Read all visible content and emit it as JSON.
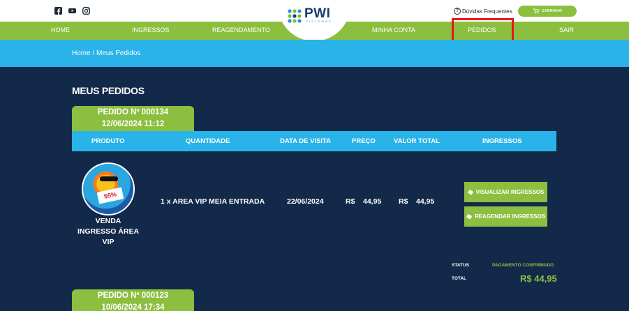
{
  "header": {
    "help_label": "Dúvidas Frequentes",
    "cart_label": "CARRINHO",
    "logo_text": "PWI",
    "logo_sub": "SISTEMAS"
  },
  "nav": {
    "items": [
      {
        "label": "HOME"
      },
      {
        "label": "INGRESSOS"
      },
      {
        "label": "REAGENDAMENTO"
      },
      {
        "label": "MINHA CONTA"
      },
      {
        "label": "PEDIDOS"
      },
      {
        "label": "SAIR"
      }
    ]
  },
  "breadcrumb": "Home / Meus Pedidos",
  "page_title": "MEUS PEDIDOS",
  "table_headers": [
    "PRODUTO",
    "QUANTIDADE",
    "DATA DE VISITA",
    "PREÇO",
    "VALOR TOTAL",
    "INGRESSOS"
  ],
  "orders": [
    {
      "number": "PEDIDO Nº 000134",
      "datetime": "12/06/2024 11:12",
      "product_name": "VENDA INGRESSO ÁREA VIP",
      "product_badge": "55%",
      "quantity": "1 x AREA VIP MEIA ENTRADA",
      "visit_date": "22/06/2024",
      "price_currency": "R$",
      "price_value": "44,95",
      "total_currency": "R$",
      "total_value": "44,95",
      "buttons": {
        "view": "VISUALIZAR INGRESSOS",
        "reschedule": "REAGENDAR INGRESSOS"
      },
      "status_label": "STATUS",
      "status_value": "PAGAMENTO CONFIRMADO",
      "total_label": "TOTAL",
      "grand_total": "R$ 44,95"
    },
    {
      "number": "PEDIDO Nº 000123",
      "datetime": "10/06/2024 17:34"
    }
  ],
  "colors": {
    "navy": "#13294a",
    "green": "#8cbf3f",
    "sky": "#29b3e8",
    "highlight": "#e8151b"
  },
  "icons": [
    "facebook-icon",
    "youtube-icon",
    "instagram-icon",
    "help-circle-icon",
    "cart-icon",
    "ticket-icon"
  ]
}
